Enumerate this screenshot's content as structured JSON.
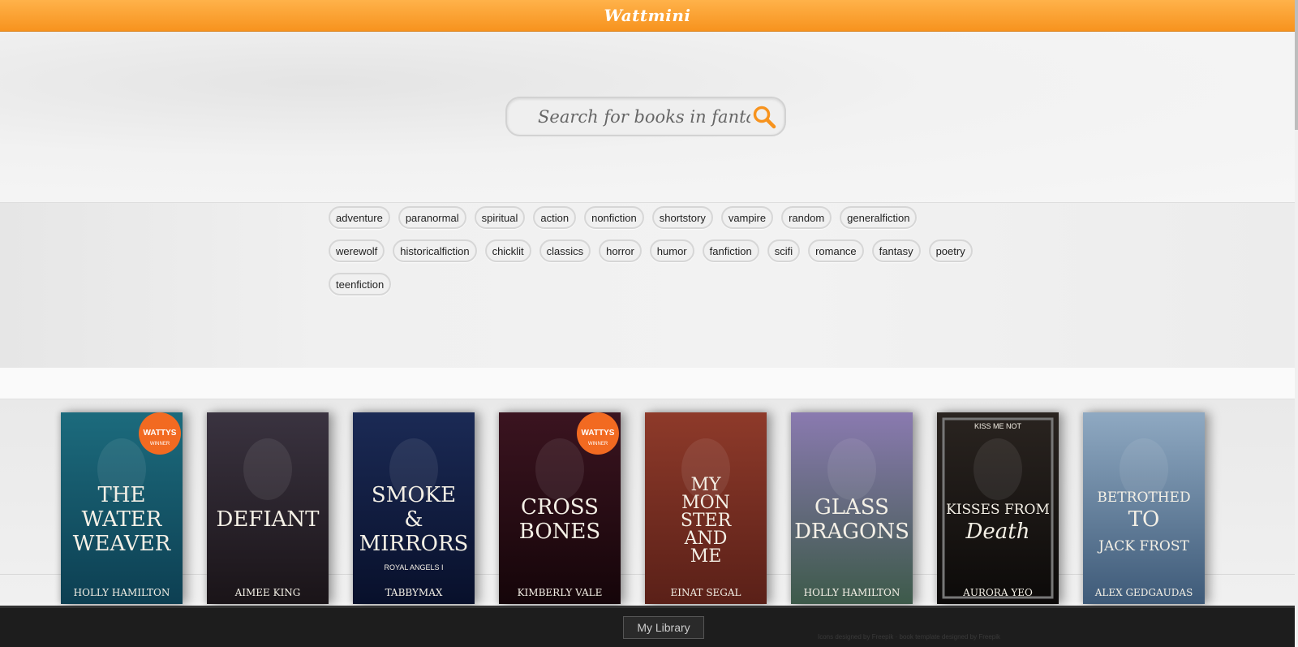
{
  "header": {
    "brand": "Wattmini"
  },
  "search": {
    "placeholder": "Search for books in fantasy",
    "icon": "search-icon",
    "accent": "#f7931e"
  },
  "tags": [
    "adventure",
    "paranormal",
    "spiritual",
    "action",
    "nonfiction",
    "shortstory",
    "vampire",
    "random",
    "generalfiction",
    "werewolf",
    "historicalfiction",
    "chicklit",
    "classics",
    "horror",
    "humor",
    "fanfiction",
    "scifi",
    "romance",
    "fantasy",
    "poetry",
    "teenfiction"
  ],
  "books": [
    {
      "title_lines": [
        "THE",
        "WATER",
        "WEAVER"
      ],
      "author": "HOLLY HAMILTON",
      "badge": "WATTYS",
      "badge_sub": "WINNER",
      "colors": [
        "#1c6b7d",
        "#0d3f52"
      ]
    },
    {
      "title_lines": [
        "DEFIANT"
      ],
      "author": "AIMEE KING",
      "badge": "",
      "badge_sub": "",
      "colors": [
        "#3a3340",
        "#1a1418"
      ]
    },
    {
      "title_lines": [
        "SMOKE",
        "&",
        "MIRRORS"
      ],
      "subtitle": "ROYAL ANGELS I",
      "author": "TABBYMAX",
      "badge": "",
      "badge_sub": "",
      "colors": [
        "#1b2a55",
        "#08102b"
      ]
    },
    {
      "title_lines": [
        "CROSS",
        "BONES"
      ],
      "author": "KIMBERLY VALE",
      "badge": "WATTYS",
      "badge_sub": "WINNER",
      "colors": [
        "#3b1420",
        "#150509"
      ]
    },
    {
      "title_lines": [
        "MY",
        "MON",
        "STER",
        "AND",
        "ME"
      ],
      "author": "EINAT SEGAL",
      "badge": "",
      "badge_sub": "",
      "colors": [
        "#8e3a2a",
        "#5a2018"
      ]
    },
    {
      "title_lines": [
        "GLASS",
        "DRAGONS"
      ],
      "author": "HOLLY HAMILTON",
      "badge": "",
      "badge_sub": "",
      "colors": [
        "#8a7ab0",
        "#3d5a4a"
      ]
    },
    {
      "title_lines": [
        "KISSES FROM",
        "Death"
      ],
      "subtitle": "KISS ME NOT",
      "author": "AURORA YEO",
      "badge": "",
      "badge_sub": "",
      "colors": [
        "#2a2420",
        "#0c0a09"
      ]
    },
    {
      "title_lines": [
        "BETROTHED",
        "TO",
        "JACK FROST"
      ],
      "author": "ALEX GEDGAUDAS",
      "badge": "",
      "badge_sub": "",
      "colors": [
        "#8fa9c2",
        "#3e5a78"
      ]
    }
  ],
  "footer": {
    "library_label": "My Library",
    "credits": "Icons designed by Freepik · book template designed by Freepik"
  }
}
